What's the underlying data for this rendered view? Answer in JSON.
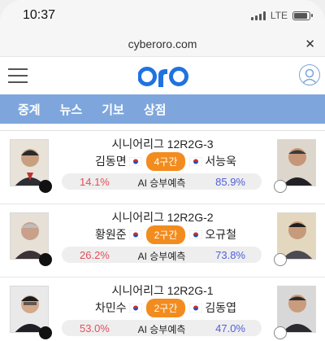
{
  "status": {
    "time": "10:37",
    "network": "LTE"
  },
  "browser": {
    "url": "cyberoro.com"
  },
  "header": {
    "logo_text": "oro",
    "colors": {
      "brand": "#1f73e0",
      "nav": "#7ea6dc",
      "badge": "#f28c1e"
    }
  },
  "nav": {
    "items": [
      "중계",
      "뉴스",
      "기보",
      "상점"
    ]
  },
  "games": [
    {
      "title": "시니어리그 12R2G-3",
      "black_player": "김동면",
      "white_player": "서능욱",
      "round": "4구간",
      "ai_label": "AI 승부예측",
      "black_pct": "14.1%",
      "white_pct": "85.9%"
    },
    {
      "title": "시니어리그 12R2G-2",
      "black_player": "황원준",
      "white_player": "오규철",
      "round": "2구간",
      "ai_label": "AI 승부예측",
      "black_pct": "26.2%",
      "white_pct": "73.8%"
    },
    {
      "title": "시니어리그 12R2G-1",
      "black_player": "차민수",
      "white_player": "김동엽",
      "round": "2구간",
      "ai_label": "AI 승부예측",
      "black_pct": "53.0%",
      "white_pct": "47.0%"
    }
  ]
}
